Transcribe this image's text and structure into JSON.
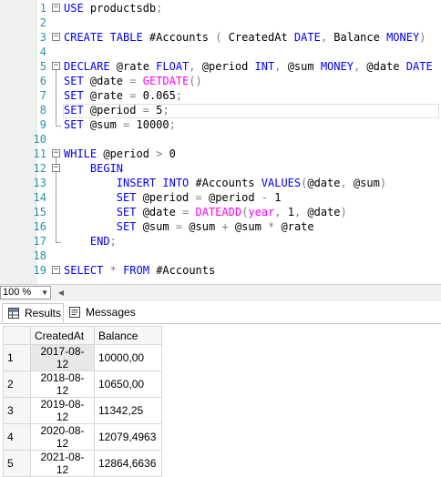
{
  "editor": {
    "line_numbers": [
      "1",
      "2",
      "3",
      "4",
      "5",
      "6",
      "7",
      "8",
      "9",
      "10",
      "11",
      "12",
      "13",
      "14",
      "15",
      "16",
      "17",
      "18",
      "19"
    ],
    "lines": [
      [
        {
          "t": "USE",
          "c": "kw"
        },
        {
          "t": " productsdb",
          "c": ""
        },
        {
          "t": ";",
          "c": "op"
        }
      ],
      [],
      [
        {
          "t": "CREATE TABLE",
          "c": "kw"
        },
        {
          "t": " #Accounts ",
          "c": ""
        },
        {
          "t": "(",
          "c": "op"
        },
        {
          "t": " CreatedAt ",
          "c": ""
        },
        {
          "t": "DATE",
          "c": "kw"
        },
        {
          "t": ",",
          "c": "op"
        },
        {
          "t": " Balance ",
          "c": ""
        },
        {
          "t": "MONEY",
          "c": "kw"
        },
        {
          "t": ")",
          "c": "op"
        }
      ],
      [],
      [
        {
          "t": "DECLARE",
          "c": "kw"
        },
        {
          "t": " @rate ",
          "c": ""
        },
        {
          "t": "FLOAT",
          "c": "kw"
        },
        {
          "t": ",",
          "c": "op"
        },
        {
          "t": " @period ",
          "c": ""
        },
        {
          "t": "INT",
          "c": "kw"
        },
        {
          "t": ",",
          "c": "op"
        },
        {
          "t": " @sum ",
          "c": ""
        },
        {
          "t": "MONEY",
          "c": "kw"
        },
        {
          "t": ",",
          "c": "op"
        },
        {
          "t": " @date ",
          "c": ""
        },
        {
          "t": "DATE",
          "c": "kw"
        }
      ],
      [
        {
          "t": "SET",
          "c": "kw"
        },
        {
          "t": " @date ",
          "c": ""
        },
        {
          "t": "=",
          "c": "op"
        },
        {
          "t": " ",
          "c": ""
        },
        {
          "t": "GETDATE",
          "c": "fn"
        },
        {
          "t": "()",
          "c": "op"
        }
      ],
      [
        {
          "t": "SET",
          "c": "kw"
        },
        {
          "t": " @rate ",
          "c": ""
        },
        {
          "t": "=",
          "c": "op"
        },
        {
          "t": " 0.065",
          "c": ""
        },
        {
          "t": ";",
          "c": "op"
        }
      ],
      [
        {
          "t": "SET",
          "c": "kw"
        },
        {
          "t": " @period ",
          "c": ""
        },
        {
          "t": "=",
          "c": "op"
        },
        {
          "t": " 5",
          "c": ""
        },
        {
          "t": ";",
          "c": "op"
        }
      ],
      [
        {
          "t": "SET",
          "c": "kw"
        },
        {
          "t": " @sum ",
          "c": ""
        },
        {
          "t": "=",
          "c": "op"
        },
        {
          "t": " 10000",
          "c": ""
        },
        {
          "t": ";",
          "c": "op"
        }
      ],
      [],
      [
        {
          "t": "WHILE",
          "c": "kw"
        },
        {
          "t": " @period ",
          "c": ""
        },
        {
          "t": ">",
          "c": "op"
        },
        {
          "t": " 0",
          "c": ""
        }
      ],
      [
        {
          "t": "    BEGIN",
          "c": "kw"
        }
      ],
      [
        {
          "t": "        ",
          "c": ""
        },
        {
          "t": "INSERT INTO",
          "c": "kw"
        },
        {
          "t": " #Accounts ",
          "c": ""
        },
        {
          "t": "VALUES",
          "c": "kw"
        },
        {
          "t": "(",
          "c": "op"
        },
        {
          "t": "@date",
          "c": ""
        },
        {
          "t": ",",
          "c": "op"
        },
        {
          "t": " @sum",
          "c": ""
        },
        {
          "t": ")",
          "c": "op"
        }
      ],
      [
        {
          "t": "        ",
          "c": ""
        },
        {
          "t": "SET",
          "c": "kw"
        },
        {
          "t": " @period ",
          "c": ""
        },
        {
          "t": "=",
          "c": "op"
        },
        {
          "t": " @period ",
          "c": ""
        },
        {
          "t": "-",
          "c": "op"
        },
        {
          "t": " 1",
          "c": ""
        }
      ],
      [
        {
          "t": "        ",
          "c": ""
        },
        {
          "t": "SET",
          "c": "kw"
        },
        {
          "t": " @date ",
          "c": ""
        },
        {
          "t": "=",
          "c": "op"
        },
        {
          "t": " ",
          "c": ""
        },
        {
          "t": "DATEADD",
          "c": "fn"
        },
        {
          "t": "(",
          "c": "op"
        },
        {
          "t": "year",
          "c": "fn"
        },
        {
          "t": ",",
          "c": "op"
        },
        {
          "t": " 1",
          "c": ""
        },
        {
          "t": ",",
          "c": "op"
        },
        {
          "t": " @date",
          "c": ""
        },
        {
          "t": ")",
          "c": "op"
        }
      ],
      [
        {
          "t": "        ",
          "c": ""
        },
        {
          "t": "SET",
          "c": "kw"
        },
        {
          "t": " @sum ",
          "c": ""
        },
        {
          "t": "=",
          "c": "op"
        },
        {
          "t": " @sum ",
          "c": ""
        },
        {
          "t": "+",
          "c": "op"
        },
        {
          "t": " @sum ",
          "c": ""
        },
        {
          "t": "*",
          "c": "op"
        },
        {
          "t": " @rate",
          "c": ""
        }
      ],
      [
        {
          "t": "    END",
          "c": "kw"
        },
        {
          "t": ";",
          "c": "op"
        }
      ],
      [],
      [
        {
          "t": "SELECT",
          "c": "kw"
        },
        {
          "t": " ",
          "c": ""
        },
        {
          "t": "*",
          "c": "op"
        },
        {
          "t": " ",
          "c": ""
        },
        {
          "t": "FROM",
          "c": "kw"
        },
        {
          "t": " #Accounts",
          "c": ""
        }
      ]
    ]
  },
  "zoom": {
    "value": "100 %"
  },
  "tabs": {
    "results_label": "Results",
    "messages_label": "Messages"
  },
  "grid": {
    "columns": [
      "CreatedAt",
      "Balance"
    ],
    "rows": [
      [
        "1",
        "2017-08-12",
        "10000,00"
      ],
      [
        "2",
        "2018-08-12",
        "10650,00"
      ],
      [
        "3",
        "2019-08-12",
        "11342,25"
      ],
      [
        "4",
        "2020-08-12",
        "12079,4963"
      ],
      [
        "5",
        "2021-08-12",
        "12864,6636"
      ]
    ]
  },
  "colors": {
    "keyword": "#0000ff",
    "function": "#ff00ff",
    "operator": "#808080",
    "line_number": "#2b91af"
  },
  "icons": {
    "results_tab": "grid-icon",
    "messages_tab": "message-icon",
    "zoom": "chevron-down-icon",
    "fold_collapse": "minus-box-icon"
  }
}
